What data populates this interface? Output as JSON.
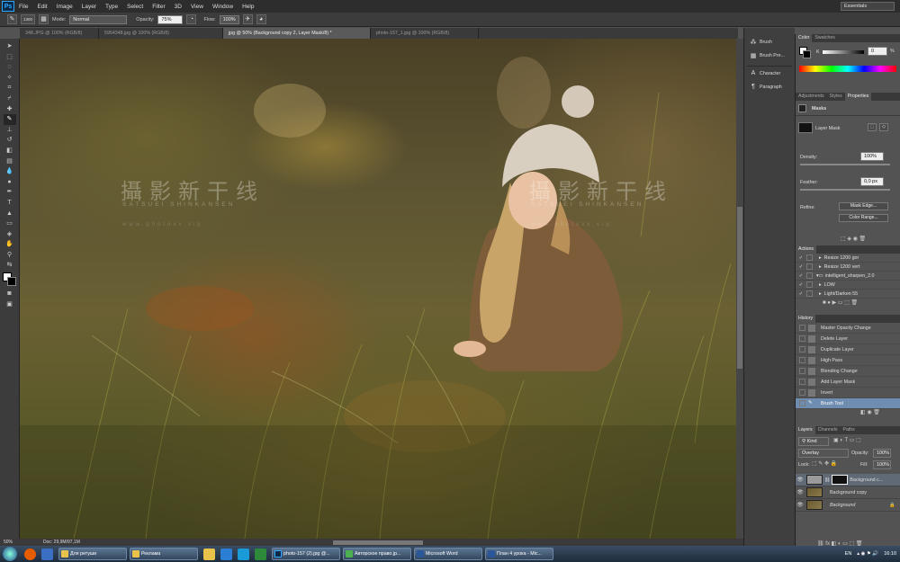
{
  "menubar": {
    "logo": "Ps",
    "items": [
      "File",
      "Edit",
      "Image",
      "Layer",
      "Type",
      "Select",
      "Filter",
      "3D",
      "View",
      "Window",
      "Help"
    ],
    "workspace": "Essentials"
  },
  "options": {
    "brush_size": "1300",
    "mode_label": "Mode:",
    "mode_value": "Normal",
    "opacity_label": "Opacity:",
    "opacity_value": "75%",
    "flow_label": "Flow:",
    "flow_value": "100%"
  },
  "tabs": [
    {
      "label": "348.JPG @ 100% (RGB/8)",
      "active": false
    },
    {
      "label": "5954348.jpg @ 100% (RGB/8)",
      "active": false
    },
    {
      "label": "jpg @ 50% (Background copy 2, Layer Mask/8) *",
      "active": true
    },
    {
      "label": "photo-157_1.jpg @ 100% (RGB/8)",
      "active": false
    }
  ],
  "canvas": {
    "watermark_cn": "攝影新干线",
    "watermark_en": "SATSUEI SHINKANSEN",
    "watermark_url": "www.photoxx.vip"
  },
  "status": {
    "zoom": "50%",
    "doc": "Doc: 29,9M/97,1M"
  },
  "dock": [
    {
      "icon": "brush-panel-icon",
      "label": "Brush"
    },
    {
      "icon": "brush-presets-icon",
      "label": "Brush Pre..."
    },
    {
      "icon": "character-icon",
      "label": "Character"
    },
    {
      "icon": "paragraph-icon",
      "label": "Paragraph"
    }
  ],
  "color": {
    "tabs": [
      "Color",
      "Swatches"
    ],
    "k_label": "K",
    "k_value": "0",
    "percent": "%"
  },
  "properties": {
    "tabs": [
      "Adjustments",
      "Styles",
      "Properties"
    ],
    "title": "Masks",
    "layer_mask": "Layer Mask",
    "density_label": "Density:",
    "density_value": "100%",
    "feather_label": "Feather:",
    "feather_value": "0,0 px",
    "refine_label": "Refine:",
    "mask_edge": "Mask Edge...",
    "color_range": "Color Range..."
  },
  "actions": {
    "title": "Actions",
    "rows": [
      "Resize 1200 gor",
      "Resize 1200 vert",
      "intelligent_sharpen_2.0",
      "LOW",
      "Light/Darken 55"
    ]
  },
  "history": {
    "title": "History",
    "rows": [
      "Master Opacity Change",
      "Delete Layer",
      "Duplicate Layer",
      "High Pass",
      "Blending Change",
      "Add Layer Mask",
      "Invert",
      "Brush Tool"
    ]
  },
  "layers": {
    "tabs": [
      "Layers",
      "Channels",
      "Paths"
    ],
    "kind": "Kind",
    "blend": "Overlay",
    "opacity_label": "Opacity:",
    "opacity_value": "100%",
    "lock_label": "Lock:",
    "fill_label": "Fill:",
    "fill_value": "100%",
    "rows": [
      {
        "name": "Background c...",
        "selected": true
      },
      {
        "name": "Background copy",
        "selected": false
      },
      {
        "name": "Background",
        "selected": false
      }
    ]
  },
  "taskbar": {
    "tasks": [
      "Для ретуши",
      "Реклама",
      "photo-157 (2).jpg @...",
      "Авторское право.jp...",
      "Microsoft Word",
      "План 4 урока - Mic..."
    ],
    "lang": "EN",
    "time": "16:10"
  }
}
